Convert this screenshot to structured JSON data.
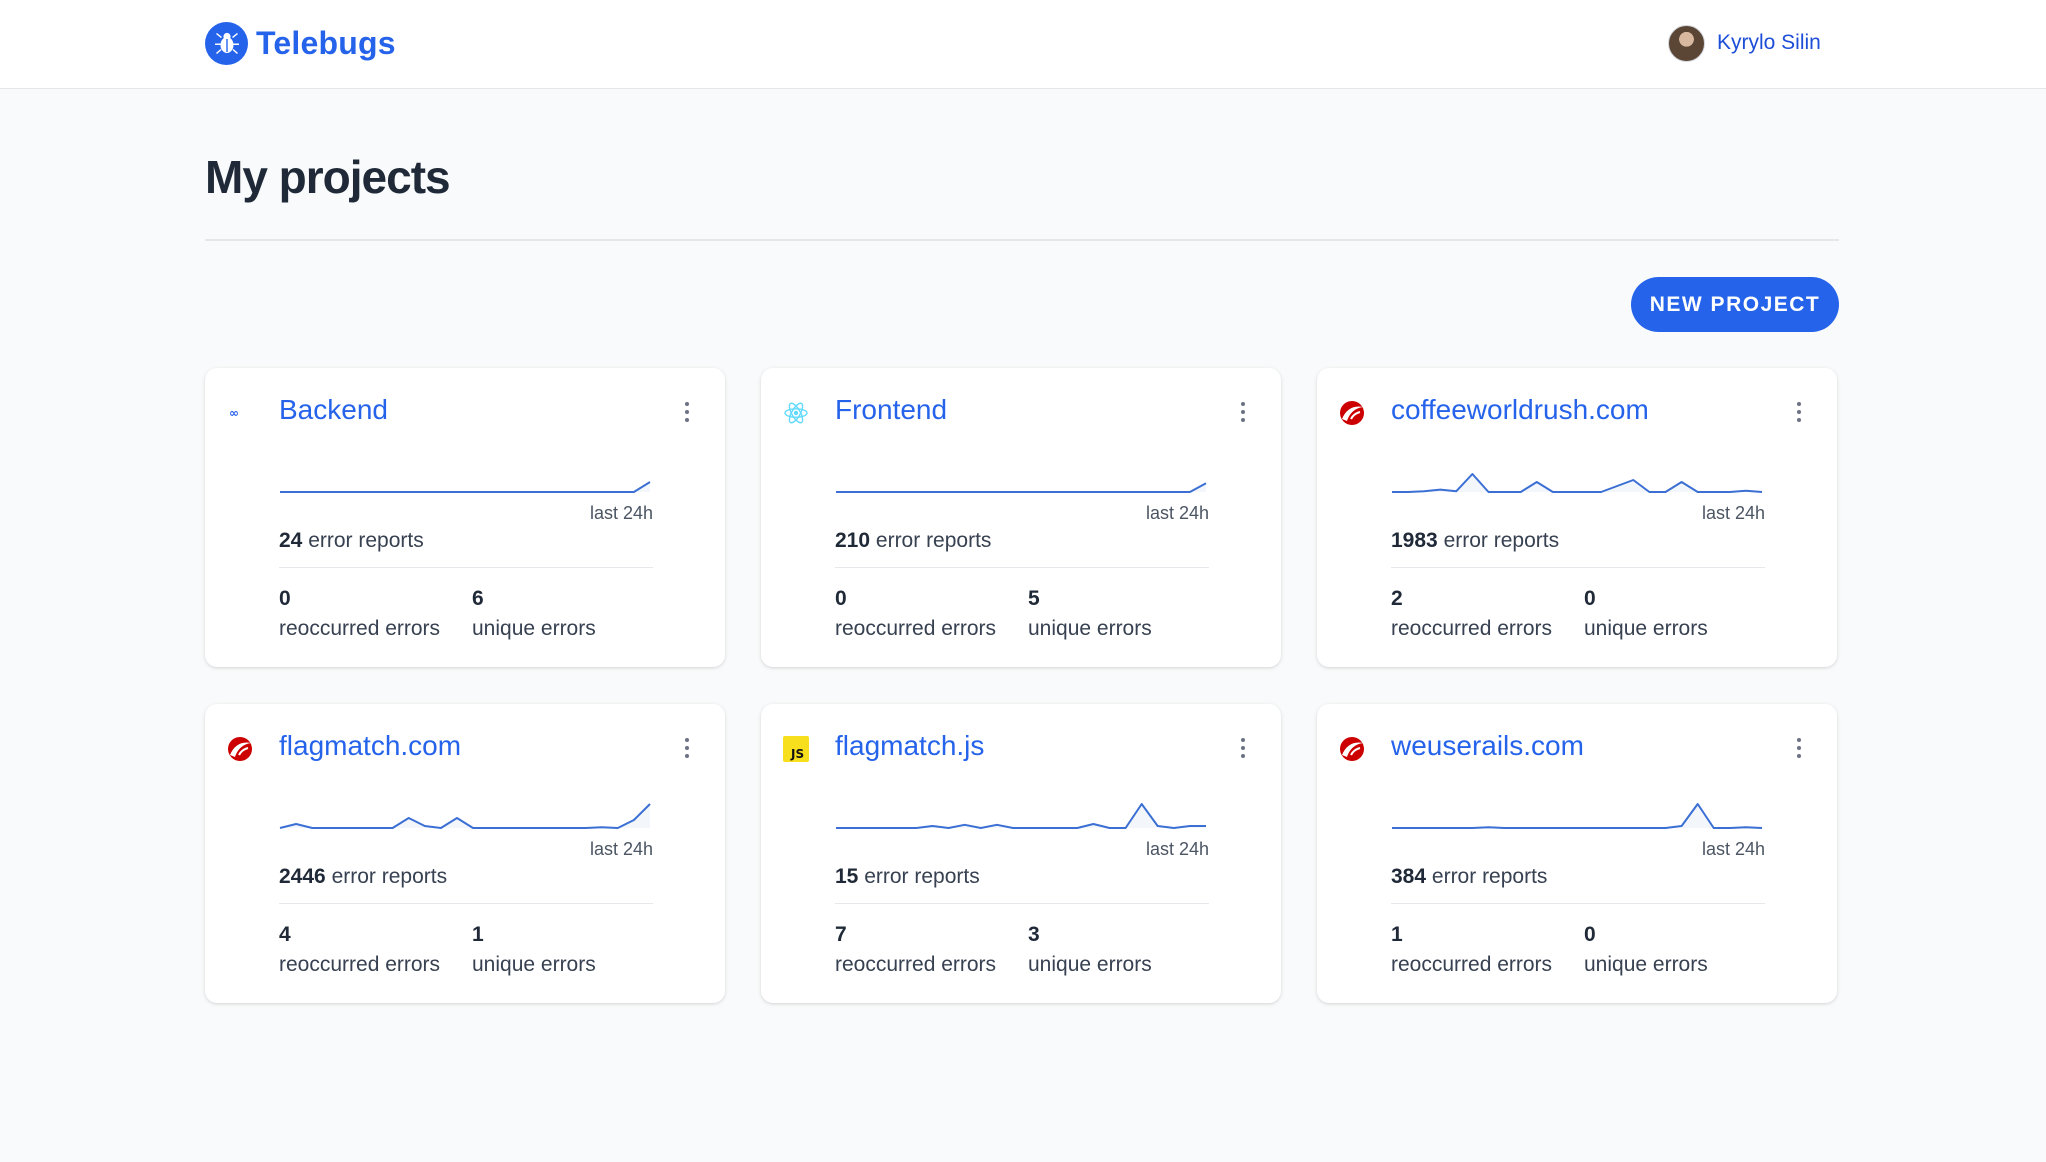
{
  "app": {
    "name": "Telebugs"
  },
  "user": {
    "name": "Kyrylo Silin"
  },
  "page": {
    "title": "My projects",
    "new_project_label": "NEW PROJECT"
  },
  "labels": {
    "last_24h": "last 24h",
    "error_reports": "error reports",
    "reoccurred_errors": "reoccurred errors",
    "unique_errors": "unique errors"
  },
  "projects": [
    {
      "name": "Backend",
      "icon": "elixir-icon",
      "error_reports": "24",
      "reoccurred": "0",
      "unique": "6",
      "trend": [
        0,
        0,
        0,
        0,
        0,
        0,
        0,
        0,
        0,
        0,
        0,
        0,
        0,
        0,
        0,
        0,
        0,
        0,
        0,
        0,
        0,
        0,
        0,
        0.25
      ]
    },
    {
      "name": "Frontend",
      "icon": "react-icon",
      "error_reports": "210",
      "reoccurred": "0",
      "unique": "5",
      "trend": [
        0,
        0,
        0,
        0,
        0,
        0,
        0,
        0,
        0,
        0,
        0,
        0,
        0,
        0,
        0,
        0,
        0,
        0,
        0,
        0,
        0,
        0,
        0,
        0.22
      ]
    },
    {
      "name": "coffeeworldrush.com",
      "icon": "rails-icon",
      "error_reports": "1983",
      "reoccurred": "2",
      "unique": "0",
      "trend": [
        0,
        0,
        0.02,
        0.06,
        0.02,
        0.45,
        0,
        0,
        0,
        0.25,
        0,
        0,
        0,
        0,
        0.15,
        0.3,
        0,
        0,
        0.25,
        0,
        0,
        0,
        0.03,
        0
      ]
    },
    {
      "name": "flagmatch.com",
      "icon": "rails-icon",
      "error_reports": "2446",
      "reoccurred": "4",
      "unique": "1",
      "trend": [
        0,
        0.1,
        0,
        0,
        0,
        0,
        0,
        0,
        0.25,
        0.05,
        0,
        0.25,
        0,
        0,
        0,
        0,
        0,
        0,
        0,
        0,
        0.02,
        0,
        0.2,
        0.6
      ]
    },
    {
      "name": "flagmatch.js",
      "icon": "js-icon",
      "error_reports": "15",
      "reoccurred": "7",
      "unique": "3",
      "trend": [
        0,
        0,
        0,
        0,
        0,
        0,
        0.05,
        0,
        0.08,
        0,
        0.08,
        0,
        0,
        0,
        0,
        0,
        0.1,
        0,
        0,
        0.6,
        0.05,
        0,
        0.05,
        0.05
      ]
    },
    {
      "name": "weuserails.com",
      "icon": "rails-icon",
      "error_reports": "384",
      "reoccurred": "1",
      "unique": "0",
      "trend": [
        0,
        0,
        0,
        0,
        0,
        0,
        0.02,
        0,
        0,
        0,
        0,
        0,
        0,
        0,
        0,
        0,
        0,
        0,
        0.05,
        0.6,
        0,
        0,
        0.02,
        0
      ]
    }
  ],
  "colors": {
    "brand": "#2563eb",
    "sparkline": "#3b6fd4",
    "rails_red": "#cc0000",
    "js_yellow": "#f7df1e"
  }
}
